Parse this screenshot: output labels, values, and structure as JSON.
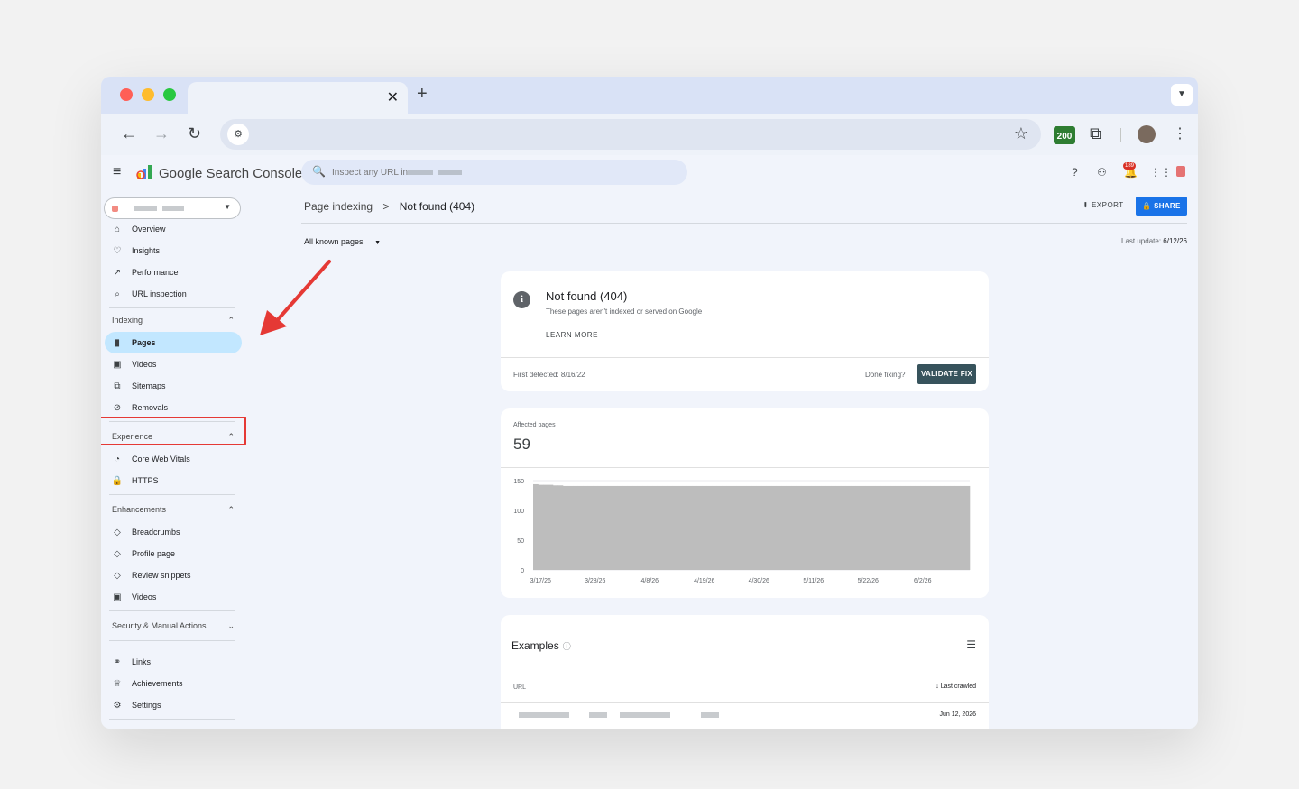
{
  "browser": {
    "tab": {
      "close": "✕"
    },
    "new_tab": "+",
    "extension_badge": "200"
  },
  "app": {
    "brand": "Google Search Console",
    "search_placeholder": "Inspect any URL in",
    "bell_count": "189"
  },
  "nav": {
    "top": [
      {
        "label": "Overview",
        "icon": "home-icon"
      },
      {
        "label": "Insights",
        "icon": "lightbulb-icon"
      },
      {
        "label": "Performance",
        "icon": "trending-icon"
      },
      {
        "label": "URL inspection",
        "icon": "search-icon"
      }
    ],
    "sections": [
      {
        "title": "Indexing",
        "items": [
          "Pages",
          "Videos",
          "Sitemaps",
          "Removals"
        ]
      },
      {
        "title": "Experience",
        "items": [
          "Core Web Vitals",
          "HTTPS"
        ]
      },
      {
        "title": "Enhancements",
        "items": [
          "Breadcrumbs",
          "Profile page",
          "Review snippets",
          "Videos"
        ]
      },
      {
        "title": "Security & Manual Actions",
        "items": []
      }
    ],
    "bottom": [
      "Links",
      "Achievements",
      "Settings"
    ],
    "active": "Pages"
  },
  "breadcrumb": {
    "parent": "Page indexing",
    "sep": ">",
    "current": "Not found (404)"
  },
  "actions": {
    "export": "EXPORT",
    "share": "SHARE"
  },
  "filter": {
    "label": "All known pages"
  },
  "last_update": {
    "label": "Last update:",
    "value": "6/12/26"
  },
  "issue": {
    "title": "Not found (404)",
    "desc": "These pages aren't indexed or served on Google",
    "learn_more": "LEARN MORE",
    "first_detected": "First detected: 8/16/22",
    "done_fixing": "Done fixing?",
    "validate": "VALIDATE FIX"
  },
  "affected": {
    "label": "Affected pages",
    "value": "59"
  },
  "examples": {
    "title": "Examples",
    "col_url": "URL",
    "col_last": "Last crawled",
    "rows": [
      {
        "date": "Jun 12, 2026"
      }
    ]
  },
  "chart_data": {
    "type": "bar",
    "ylim": [
      0,
      150
    ],
    "yticks": [
      0,
      50,
      100,
      150
    ],
    "xticks": [
      "3/17/26",
      "3/28/26",
      "4/8/26",
      "4/19/26",
      "4/30/26",
      "5/11/26",
      "5/22/26",
      "6/2/26"
    ],
    "x_start": "3/16/26",
    "color": "#bdbdbd",
    "values": [
      144,
      143,
      143,
      143,
      142,
      142,
      141,
      141,
      141,
      141,
      141,
      141,
      141,
      141,
      141,
      141,
      141,
      141,
      141,
      141,
      141,
      141,
      141,
      141,
      141,
      141,
      141,
      141,
      141,
      141,
      141,
      141,
      141,
      141,
      141,
      141,
      141,
      141,
      141,
      141,
      141,
      141,
      141,
      141,
      141,
      141,
      141,
      141,
      141,
      141,
      141,
      141,
      141,
      141,
      141,
      141,
      141,
      141,
      141,
      141,
      141,
      141,
      141,
      141,
      141,
      141,
      141,
      141,
      141,
      141,
      141,
      141,
      141,
      141,
      141,
      141,
      141,
      141,
      141,
      141,
      141,
      141,
      141,
      141,
      141,
      141,
      141,
      141
    ]
  }
}
